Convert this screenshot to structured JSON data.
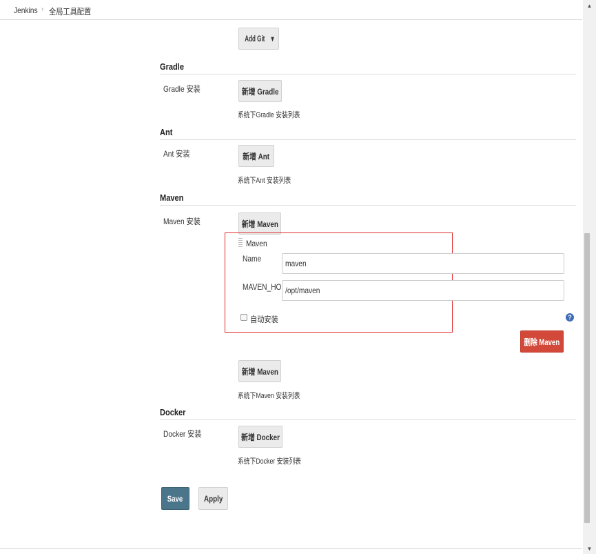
{
  "breadcrumb": {
    "root": "Jenkins",
    "separator": "›",
    "current": "全局工具配置"
  },
  "git": {
    "add_button": "Add Git",
    "dropdown_arrow": "▾"
  },
  "gradle": {
    "title": "Gradle",
    "install_label": "Gradle 安装",
    "add_button": "新增 Gradle",
    "desc": "系统下Gradle 安装列表"
  },
  "ant": {
    "title": "Ant",
    "install_label": "Ant 安装",
    "add_button": "新增 Ant",
    "desc": "系统下Ant 安装列表"
  },
  "maven": {
    "title": "Maven",
    "install_label": "Maven 安装",
    "add_button_top": "新增 Maven",
    "item_header": "Maven",
    "name_label": "Name",
    "name_value": "maven",
    "home_label": "MAVEN_HOME",
    "home_value": "/opt/maven",
    "auto_install_label": "自动安装",
    "auto_install_checked": false,
    "help_icon": "?",
    "delete_button": "删除 Maven",
    "add_button_bottom": "新增 Maven",
    "desc": "系统下Maven 安装列表"
  },
  "docker": {
    "title": "Docker",
    "install_label": "Docker 安装",
    "add_button": "新增 Docker",
    "desc": "系统下Docker 安装列表"
  },
  "footer": {
    "save": "Save",
    "apply": "Apply"
  },
  "colors": {
    "highlight_box": "#e0262a",
    "danger": "#d24939",
    "primary": "#4b758b",
    "help": "#3f6cb5"
  }
}
